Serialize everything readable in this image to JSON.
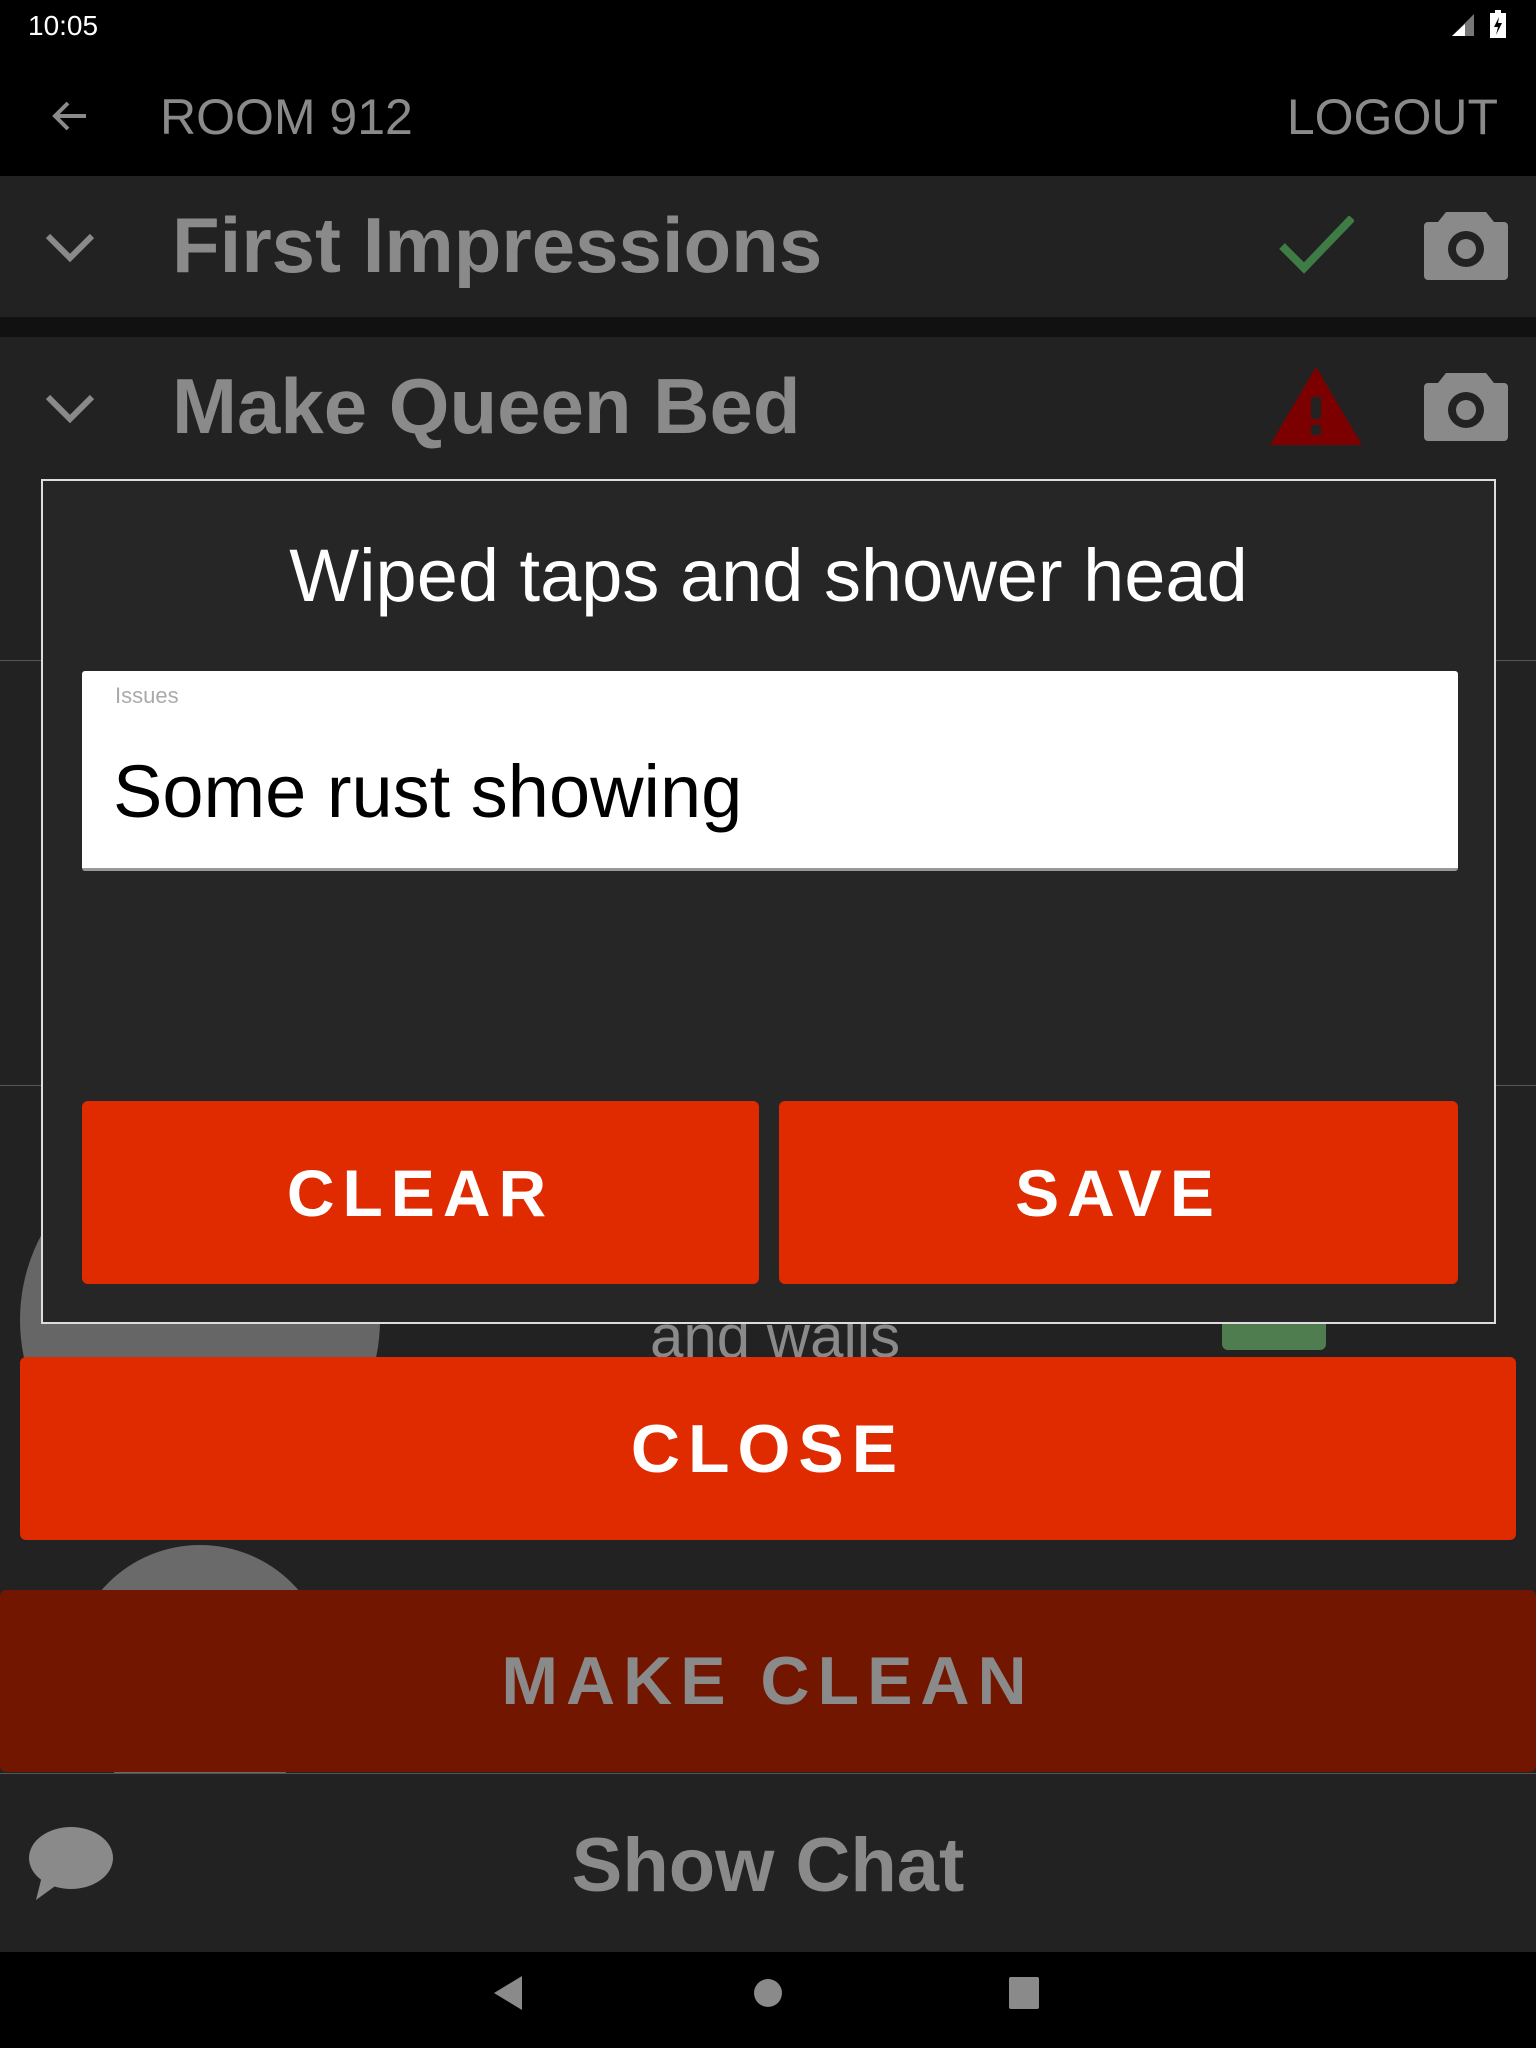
{
  "status_bar": {
    "time": "10:05",
    "icons": [
      "signal-icon",
      "battery-charging-icon"
    ]
  },
  "app_bar": {
    "title": "ROOM 912",
    "logout_label": "LOGOUT",
    "back_icon": "arrow-left-icon"
  },
  "sections": [
    {
      "title": "First Impressions",
      "status": "complete",
      "status_color": "#3f7b45"
    },
    {
      "title": "Make Queen Bed",
      "status": "warning",
      "status_color": "#7d0000"
    }
  ],
  "background": {
    "partial_text": "and walls"
  },
  "dialog": {
    "title": "Wiped taps and shower head",
    "field_label": "Issues",
    "field_value": "Some rust showing",
    "clear_label": "CLEAR",
    "save_label": "SAVE"
  },
  "close_label": "CLOSE",
  "make_clean_label": "MAKE CLEAN",
  "show_chat_label": "Show Chat",
  "colors": {
    "accent": "#e02a00",
    "accent_dim": "#731600",
    "bg": "#222222"
  }
}
